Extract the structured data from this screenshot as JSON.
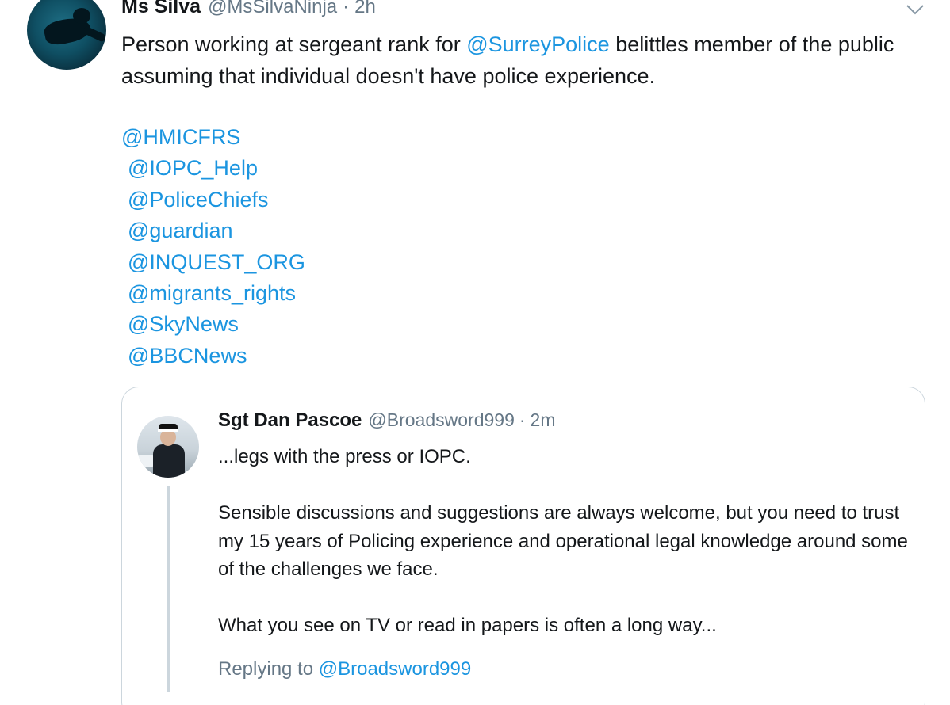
{
  "tweet": {
    "author_name": "Ms Silva",
    "author_handle": "@MsSilvaNinja",
    "separator": "·",
    "timestamp": "2h",
    "text_before": "Person working at sergeant rank for ",
    "text_mention": "@SurreyPolice",
    "text_after": " belittles member of the public assuming that individual doesn't have police experience.",
    "mentions": [
      "@HMICFRS",
      "@IOPC_Help",
      "@PoliceChiefs",
      "@guardian",
      "@INQUEST_ORG",
      "@migrants_rights",
      "@SkyNews",
      "@BBCNews"
    ],
    "menu_icon": "chevron-down-icon"
  },
  "quoted_tweet": {
    "author_name": "Sgt Dan Pascoe",
    "author_handle": "@Broadsword999",
    "separator": "·",
    "timestamp": "2m",
    "paragraphs": [
      "...legs with the press or IOPC.",
      "Sensible discussions and suggestions are always welcome, but you need to trust my 15 years of Policing experience and operational legal knowledge around some of the challenges we face.",
      "What you see on TV or read in papers is often a long way..."
    ],
    "replying_label": "Replying to ",
    "replying_to": "@Broadsword999"
  },
  "colors": {
    "link": "#1b95e0",
    "muted": "#657786",
    "text": "#14171a",
    "border": "#ccd6dd"
  }
}
